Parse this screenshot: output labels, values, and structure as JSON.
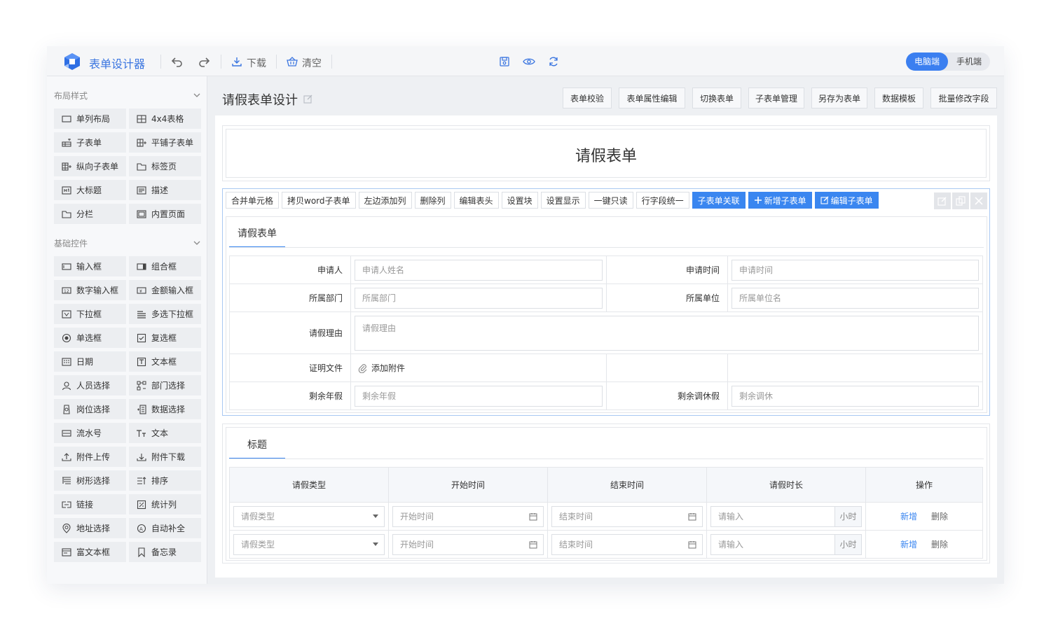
{
  "app": {
    "title": "表单设计器"
  },
  "toolbar": {
    "download_label": "下载",
    "clear_label": "清空"
  },
  "device_toggle": {
    "desktop": "电脑端",
    "mobile": "手机端"
  },
  "sidebar": {
    "layout_section": "布局样式",
    "layout_items": [
      {
        "label": "单列布局"
      },
      {
        "label": "4x4表格"
      },
      {
        "label": "子表单"
      },
      {
        "label": "平铺子表单"
      },
      {
        "label": "纵向子表单"
      },
      {
        "label": "标签页"
      },
      {
        "label": "大标题"
      },
      {
        "label": "描述"
      },
      {
        "label": "分栏"
      },
      {
        "label": "内置页面"
      }
    ],
    "basic_section": "基础控件",
    "basic_items": [
      {
        "label": "输入框"
      },
      {
        "label": "组合框"
      },
      {
        "label": "数字输入框"
      },
      {
        "label": "金额输入框"
      },
      {
        "label": "下拉框"
      },
      {
        "label": "多选下拉框"
      },
      {
        "label": "单选框"
      },
      {
        "label": "复选框"
      },
      {
        "label": "日期"
      },
      {
        "label": "文本框"
      },
      {
        "label": "人员选择"
      },
      {
        "label": "部门选择"
      },
      {
        "label": "岗位选择"
      },
      {
        "label": "数据选择"
      },
      {
        "label": "流水号"
      },
      {
        "label": "文本"
      },
      {
        "label": "附件上传"
      },
      {
        "label": "附件下载"
      },
      {
        "label": "树形选择"
      },
      {
        "label": "排序"
      },
      {
        "label": "链接"
      },
      {
        "label": "统计列"
      },
      {
        "label": "地址选择"
      },
      {
        "label": "自动补全"
      },
      {
        "label": "富文本框"
      },
      {
        "label": "备忘录"
      }
    ]
  },
  "main": {
    "page_title": "请假表单设计",
    "top_buttons": [
      "表单校验",
      "表单属性编辑",
      "切换表单",
      "子表单管理",
      "另存为表单",
      "数据模板",
      "批量修改字段"
    ],
    "form_title": "请假表单",
    "block_ops": [
      "合并单元格",
      "拷贝word子表单",
      "左边添加列",
      "删除列",
      "编辑表头",
      "设置块",
      "设置显示",
      "一键只读",
      "行字段统一"
    ],
    "block_ops_primary": {
      "link": "子表单关联",
      "add": "新增子表单",
      "edit": "编辑子表单"
    },
    "tab1": "请假表单",
    "fields": {
      "applicant_label": "申请人",
      "applicant_ph": "申请人姓名",
      "apply_time_label": "申请时间",
      "apply_time_ph": "申请时间",
      "dept_label": "所属部门",
      "dept_ph": "所属部门",
      "unit_label": "所属单位",
      "unit_ph": "所属单位名",
      "reason_label": "请假理由",
      "reason_ph": "请假理由",
      "proof_label": "证明文件",
      "attach_label": "添加附件",
      "annual_label": "剩余年假",
      "annual_ph": "剩余年假",
      "comp_label": "剩余调休假",
      "comp_ph": "剩余调休"
    },
    "tab2": "标题",
    "subtable": {
      "headers": [
        "请假类型",
        "开始时间",
        "结束时间",
        "请假时长",
        "操作"
      ],
      "type_ph": "请假类型",
      "start_ph": "开始时间",
      "end_ph": "结束时间",
      "dur_ph": "请输入",
      "unit": "小时",
      "add": "新增",
      "del": "删除"
    }
  },
  "colors": {
    "accent": "#3a86f0",
    "brand": "#3a75e0"
  }
}
